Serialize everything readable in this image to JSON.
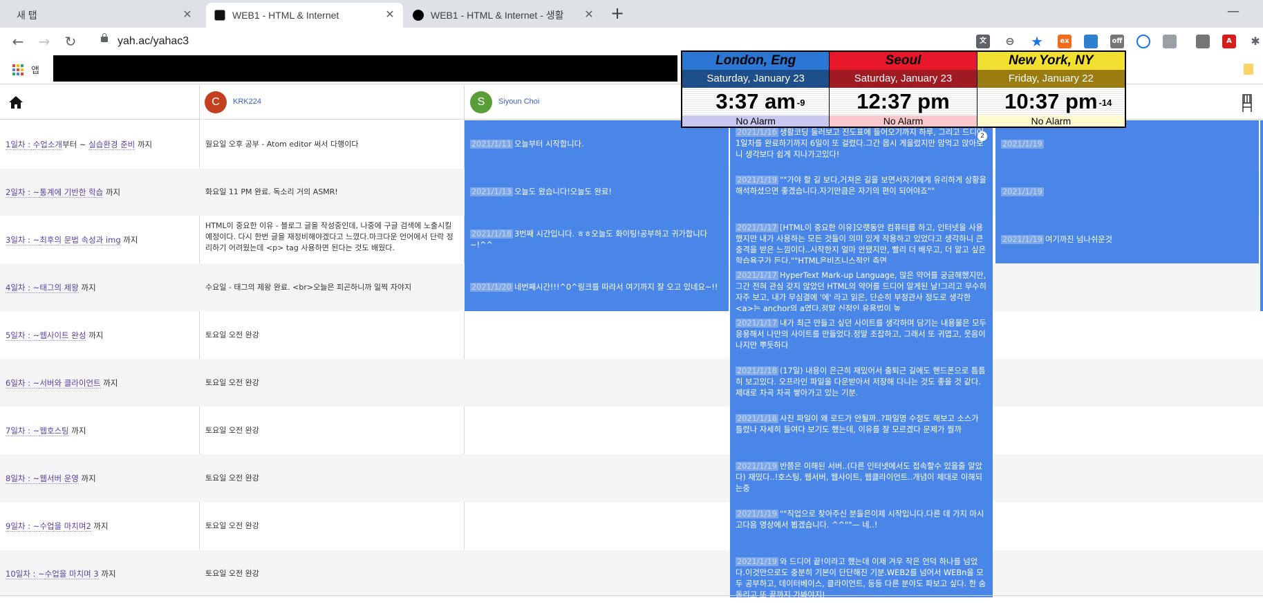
{
  "browser": {
    "tabs": [
      {
        "title": "새 탭",
        "close": "✕"
      },
      {
        "title": "WEB1 - HTML & Internet",
        "close": "✕"
      },
      {
        "title": "WEB1 - HTML & Internet - 생활",
        "close": "✕"
      }
    ],
    "new_tab": "+",
    "minimize": "—",
    "url": "yah.ac/yahac3",
    "bookmarks_apps": "앱"
  },
  "users": [
    {
      "initial": "C",
      "name": "KRK224",
      "color": "#c1401f"
    },
    {
      "initial": "S",
      "name": "Siyoun Choi",
      "color": "#5a9e3a"
    }
  ],
  "lessons": [
    {
      "prefix": "1일차 : ",
      "link": "수업소개",
      "mid": "부터 ~ ",
      "link2": "실습환경 준비",
      "suffix": " 까지"
    },
    {
      "prefix": "2일차 : ~",
      "link": "통계에 기반한 학습",
      "mid": "",
      "link2": "",
      "suffix": " 까지"
    },
    {
      "prefix": "3일차 : ~",
      "link": "최후의 문법 속성과 img",
      "mid": "",
      "link2": "",
      "suffix": " 까지"
    },
    {
      "prefix": "4일차 : ~",
      "link": "태그의 제왕",
      "mid": "",
      "link2": "",
      "suffix": " 까지"
    },
    {
      "prefix": "5일차 : ~",
      "link": "웹사이트 완성",
      "mid": "",
      "link2": "",
      "suffix": " 까지"
    },
    {
      "prefix": "6일차 : ~",
      "link": "서버와 클라이언트",
      "mid": "",
      "link2": "",
      "suffix": " 까지"
    },
    {
      "prefix": "7일차 : ~",
      "link": "웹호스팅",
      "mid": "",
      "link2": "",
      "suffix": " 까지"
    },
    {
      "prefix": "8일차 : ~",
      "link": "웹서버 운영",
      "mid": "",
      "link2": "",
      "suffix": " 까지"
    },
    {
      "prefix": "9일차 : ~",
      "link": "수업을 마치며2",
      "mid": "",
      "link2": "",
      "suffix": " 까지"
    },
    {
      "prefix": "10일차 : ~",
      "link": "수업을 마치며 3",
      "mid": "",
      "link2": "",
      "suffix": " 까지"
    }
  ],
  "notes": [
    "월요일 오후 공부 - Atom editor 써서 다행이다",
    "화요일 11 PM 완료. 독소리 거의 ASMR!",
    "HTML이 중요한 이유 - 블로그 글을 작성중인데, 나중에 구글 검색에 노출시킬 예정이다. 다시 한번 글을 재정비해야겠다고 느꼈다.마크다운 언어에서 단락 정리하기 어려웠는데 <p> tag 사용하면 된다는 것도 배웠다.",
    "수요일 - 태그의 제왕 완료. <br>오늘은 피곤하니까 일찍 자야지",
    "토요일 오전 완강",
    "토요일 오전 완강",
    "토요일 오전 완강",
    "토요일 오전 완강",
    "토요일 오전 완강",
    "토요일 오전 완강"
  ],
  "col_siyoun": [
    {
      "date": "2021/1/11",
      "text": "오늘부터 시작합니다."
    },
    {
      "date": "2021/1/13",
      "text": "오늘도 왔습니다!오늘도 완료!"
    },
    {
      "date": "2021/1/18",
      "text": "3번째 시간입니다. ㅎㅎ오늘도 화이팅!공부하고 귀가합니다~!^^"
    },
    {
      "date": "2021/1/20",
      "text": "네번째시간!!!^0^링크를 따라서 여기까지 잘 오고 있네요~!!"
    }
  ],
  "col_third": [
    {
      "date": "2021/1/16",
      "text": "생활코딩 둘러보고 진도표에 들어오기까지 하루, 그리고 드디어 1일차를 완료하기까지 6일이 또 걸렸다.그간 몹시 게을렀지만 맘먹고 앉아보니 생각보다 쉽게 지나가고있다!",
      "badge": "2"
    },
    {
      "date": "2021/1/19",
      "text": "\"\"가야 할 길 보다,거쳐온 길을 보면서자기에게 유리하게 상황을 해석하셨으면 좋겠습니다.자기만큼은 자기의 편이 되어야죠\"\""
    },
    {
      "date": "2021/1/17",
      "text": "[HTML이 중요한 이유]오랫동안 컴퓨터를 하고, 인터넷을 사용했지만 내가 사용하는 모든 것들이 의미 있게 작용하고 있었다고 생각하니 큰 충격을 받은 느낌이다..시작한지 얼마 안됐지만, 빨리 더 배우고, 더 알고 싶은 학습욕구가 든다.\"\"HTML은비즈니스적인 측면"
    },
    {
      "date": "2021/1/17",
      "text": "HyperText Mark-up Language, 많은 약어를 궁금해했지만, 그간 전혀 관심 갖지 않았던 HTML의 약어를 드디어 알게된 날!그리고 무수히 자주 보고, 내가 무심결에 '에' 라고 읽은, 단순히 부정관사 정도로 생각한 <a>는 anchor의 a였다.정말 신정인 유용법이 높"
    },
    {
      "date": "2021/1/17",
      "text": "내가 최근 만들고 싶던 사이트를 생각하며 담기는 내용물은 모두 응용해서 나만의 사이트를 만들었다.정말 조잡하고, 그래서 또 귀엽고, 웃음이 나지만 뿌듯하다"
    },
    {
      "date": "2021/1/18",
      "text": "(17일) 내용이 은근히 재밌어서 출퇴근 길에도 핸드폰으로 틈틈히 보고있다. 오프라인 파일을 다운받아서 저장해 다니는 것도 좋을 것 같다. 제대로 차곡 차곡 쌓아가고 있는 기분."
    },
    {
      "date": "2021/1/18",
      "text": "사진 파일이 왜 로드가 안될까..?파일명 수정도 해보고 소스가 틀렸나 자세히 들여다 보기도 했는데, 이유를 잘 모르겠다 문제가 뭘까"
    },
    {
      "date": "2021/1/19",
      "text": "반쯤은 이해된 서버..(다른 인터넷에서도 접속할수 있을줄 알았다) 재밌다..!호스팅, 웹서버, 웹사이트, 웹클라이언트..개념이 제대로 이해되는중"
    },
    {
      "date": "2021/1/19",
      "text": "\"\"직업으로 찾아주신 분들은이제 시작입니다.다른 데 가지 마시고다음 영상에서 뵙겠습니다. ^^\"\"— 네..!"
    },
    {
      "date": "2021/1/19",
      "text": "와 드디어 끝!이라고 했는데 이제 겨우 작은 언덕 하나를 넘었다.이것만으로도 충분히 기본이 단단해진 기분.WEB2를 넘어서 WEBn을 모두 공부하고, 데이터베이스, 클라이언트, 등등 다른 분야도 파보고 싶다. 한 숨 돌리고 또 끝까지 가봐야지!"
    }
  ],
  "col_fourth": [
    {
      "date": "2021/1/19",
      "text": ""
    },
    {
      "date": "2021/1/19",
      "text": ""
    },
    {
      "date": "2021/1/19",
      "text": "여기까진 넘나쉬운것"
    }
  ],
  "clocks": [
    {
      "city": "London, Eng",
      "date": "Saturday, January 23",
      "time": "3:37 am",
      "offset": "-9",
      "alarm": "No Alarm",
      "city_bg": "#2a76d2",
      "date_bg": "#1f4f8a",
      "alarm_bg": "#c8c8f0"
    },
    {
      "city": "Seoul",
      "date": "Saturday, January 23",
      "time": "12:37 pm",
      "offset": "",
      "alarm": "No Alarm",
      "city_bg": "#e8182a",
      "date_bg": "#a01a22",
      "alarm_bg": "#f8c8cc"
    },
    {
      "city": "New York, NY",
      "date": "Friday, January 22",
      "time": "10:37 pm",
      "offset": "-14",
      "alarm": "No Alarm",
      "city_bg": "#f2e030",
      "date_bg": "#9a7c10",
      "alarm_bg": "#fffad0"
    }
  ]
}
